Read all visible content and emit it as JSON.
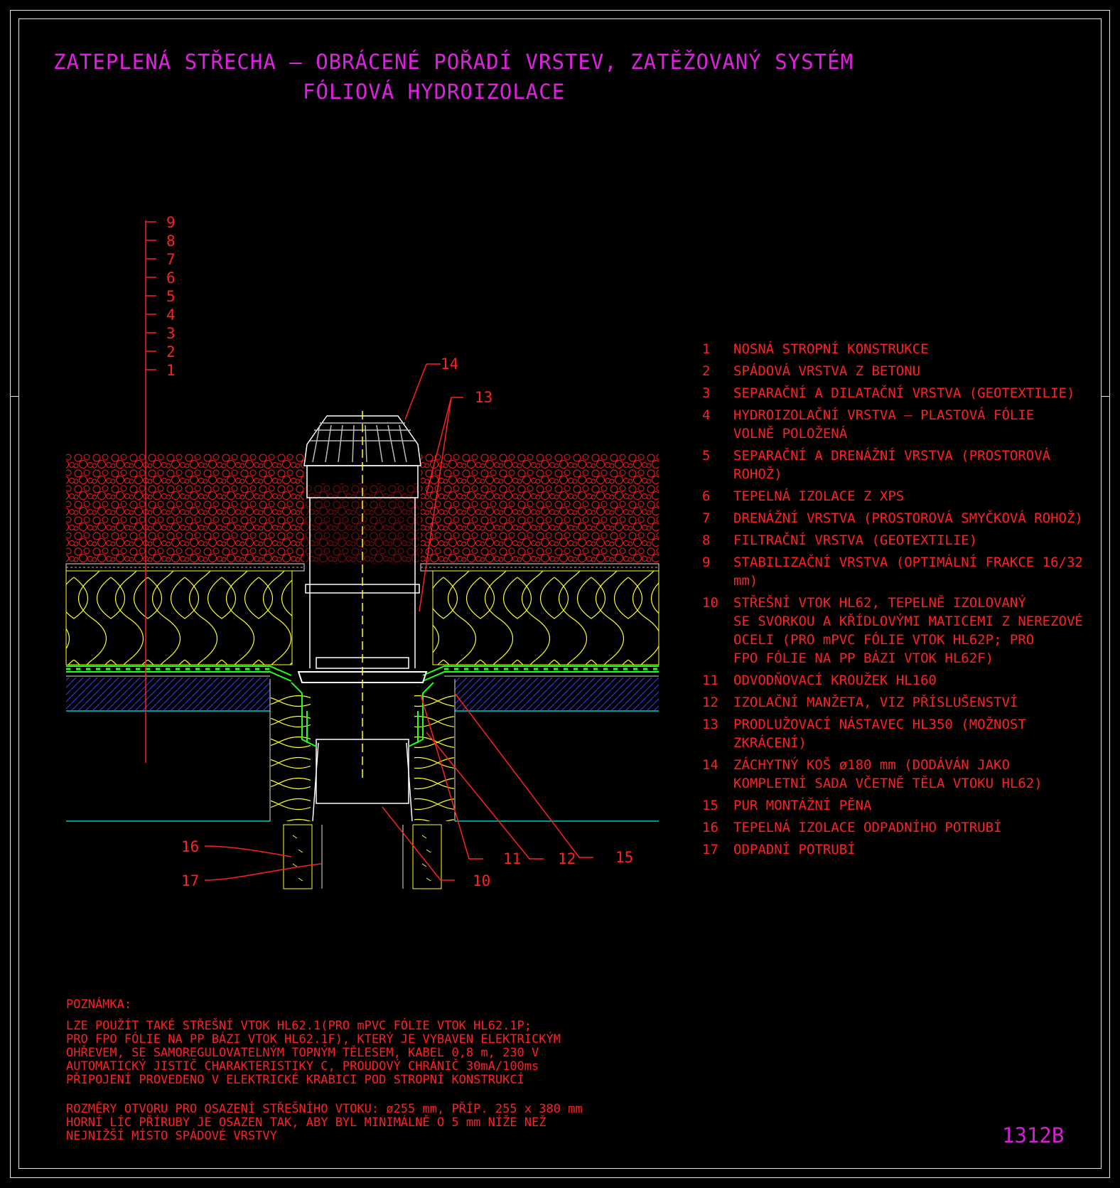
{
  "title_line1": "ZATEPLENÁ STŘECHA – OBRÁCENÉ POŘADÍ VRSTEV, ZATĚŽOVANÝ SYSTÉM",
  "title_line2": "FÓLIOVÁ HYDROIZOLACE",
  "layer_scale": [
    "9",
    "8",
    "7",
    "6",
    "5",
    "4",
    "3",
    "2",
    "1"
  ],
  "callouts": {
    "c10": "10",
    "c11": "11",
    "c12": "12",
    "c13": "13",
    "c14": "14",
    "c15": "15",
    "c16": "16",
    "c17": "17"
  },
  "legend": [
    {
      "num": "1",
      "text": "NOSNÁ STROPNÍ KONSTRUKCE"
    },
    {
      "num": "2",
      "text": "SPÁDOVÁ VRSTVA Z BETONU"
    },
    {
      "num": "3",
      "text": "SEPARAČNÍ A DILATAČNÍ VRSTVA (GEOTEXTILIE)"
    },
    {
      "num": "4",
      "text": "HYDROIZOLAČNÍ VRSTVA – PLASTOVÁ FÓLIE\nVOLNĚ POLOŽENÁ"
    },
    {
      "num": "5",
      "text": "SEPARAČNÍ A DRENÁŽNÍ VRSTVA (PROSTOROVÁ ROHOŽ)"
    },
    {
      "num": "6",
      "text": "TEPELNÁ IZOLACE Z XPS"
    },
    {
      "num": "7",
      "text": "DRENÁŽNÍ VRSTVA (PROSTOROVÁ SMYČKOVÁ ROHOŽ)"
    },
    {
      "num": "8",
      "text": "FILTRAČNÍ VRSTVA (GEOTEXTILIE)"
    },
    {
      "num": "9",
      "text": "STABILIZAČNÍ VRSTVA (OPTIMÁLNÍ FRAKCE 16/32 mm)"
    },
    {
      "num": "10",
      "text": "STŘEŠNÍ VTOK HL62, TEPELNĚ IZOLOVANÝ\nSE SVORKOU A KŘÍDLOVÝMI MATICEMI Z NEREZOVÉ\nOCELI (PRO mPVC FÓLIE VTOK HL62P; PRO\nFPO FÓLIE NA PP BÁZI VTOK HL62F)"
    },
    {
      "num": "11",
      "text": "ODVODŇOVACÍ KROUŽEK HL160"
    },
    {
      "num": "12",
      "text": "IZOLAČNÍ MANŽETA, VIZ PŘÍSLUŠENSTVÍ"
    },
    {
      "num": "13",
      "text": "PRODLUŽOVACÍ NÁSTAVEC HL350 (MOŽNOST ZKRÁCENÍ)"
    },
    {
      "num": "14",
      "text": "ZÁCHYTNÝ KOŠ ø180 mm (DODÁVÁN JAKO\nKOMPLETNÍ SADA VČETNĚ TĚLA VTOKU HL62)"
    },
    {
      "num": "15",
      "text": "PUR MONTÁŽNÍ PĚNA"
    },
    {
      "num": "16",
      "text": "TEPELNÁ IZOLACE ODPADNÍHO POTRUBÍ"
    },
    {
      "num": "17",
      "text": "ODPADNÍ POTRUBÍ"
    }
  ],
  "note": {
    "heading": "POZNÁMKA:",
    "paragraph1": "LZE POUŽÍT TAKÉ STŘEŠNÍ VTOK HL62.1(PRO mPVC FÓLIE VTOK HL62.1P;\nPRO FPO FÓLIE NA PP BÁZI VTOK HL62.1F), KTERÝ JE VYBAVEN ELEKTRICKÝM\nOHŘEVEM, SE SAMOREGULOVATELNÝM TOPNÝM TĚLESEM, KABEL 0,8 m, 230 V\nAUTOMATICKÝ JISTIČ CHARAKTERISTIKY C, PROUDOVÝ CHRÁNIČ 30mA/100ms\nPŘIPOJENÍ PROVEDENO V ELEKTRICKÉ KRABICI POD STROPNÍ KONSTRUKCÍ",
    "paragraph2": "ROZMĚRY OTVORU PRO OSAZENÍ STŘEŠNÍHO VTOKU: ø255 mm, PŘÍP. 255 x 380 mm\nHORNÍ LÍC PŘÍRUBY JE OSAZEN TAK, ABY BYL MINIMÁLNĚ O 5 mm NÍŽE NEŽ\nNEJNIŽŠÍ MÍSTO SPÁDOVÉ VRSTVY"
  },
  "drawing_code": "1312B",
  "colors": {
    "gravel": "#ff1a1a",
    "insulation": "#ffff20",
    "membrane": "#20ff20",
    "concrete_hatch": "#3030ff",
    "slab_line": "#00c8c8",
    "drain": "#ffffff",
    "leader": "#ff2020",
    "title": "#e020e0"
  }
}
